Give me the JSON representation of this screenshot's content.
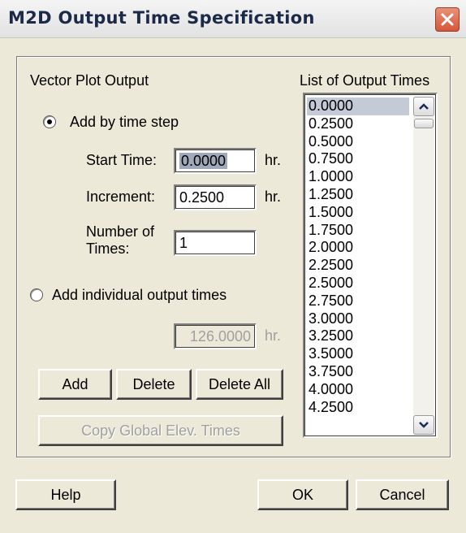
{
  "window": {
    "title": "M2D Output Time Specification"
  },
  "group": {
    "title": "Vector Plot Output",
    "list_title": "List of Output Times"
  },
  "time_step": {
    "radio_label": "Add by time step",
    "checked": true,
    "start_label": "Start Time:",
    "start_value": "0.0000",
    "increment_label": "Increment:",
    "increment_value": "0.2500",
    "number_label_line1": "Number of",
    "number_label_line2": "Times:",
    "number_value": "1",
    "unit": "hr."
  },
  "individual": {
    "radio_label": "Add individual output times",
    "checked": false,
    "value": "126.0000",
    "unit": "hr."
  },
  "buttons": {
    "add": "Add",
    "delete": "Delete",
    "delete_all": "Delete All",
    "copy_global": "Copy Global Elev. Times",
    "help": "Help",
    "ok": "OK",
    "cancel": "Cancel"
  },
  "output_times": [
    "0.0000",
    "0.2500",
    "0.5000",
    "0.7500",
    "1.0000",
    "1.2500",
    "1.5000",
    "1.7500",
    "2.0000",
    "2.2500",
    "2.5000",
    "2.7500",
    "3.0000",
    "3.2500",
    "3.5000",
    "3.7500",
    "4.0000",
    "4.2500"
  ],
  "selected_time_index": 0,
  "colors": {
    "close_button": "#d5563a",
    "selection": "#c4cbd7"
  }
}
